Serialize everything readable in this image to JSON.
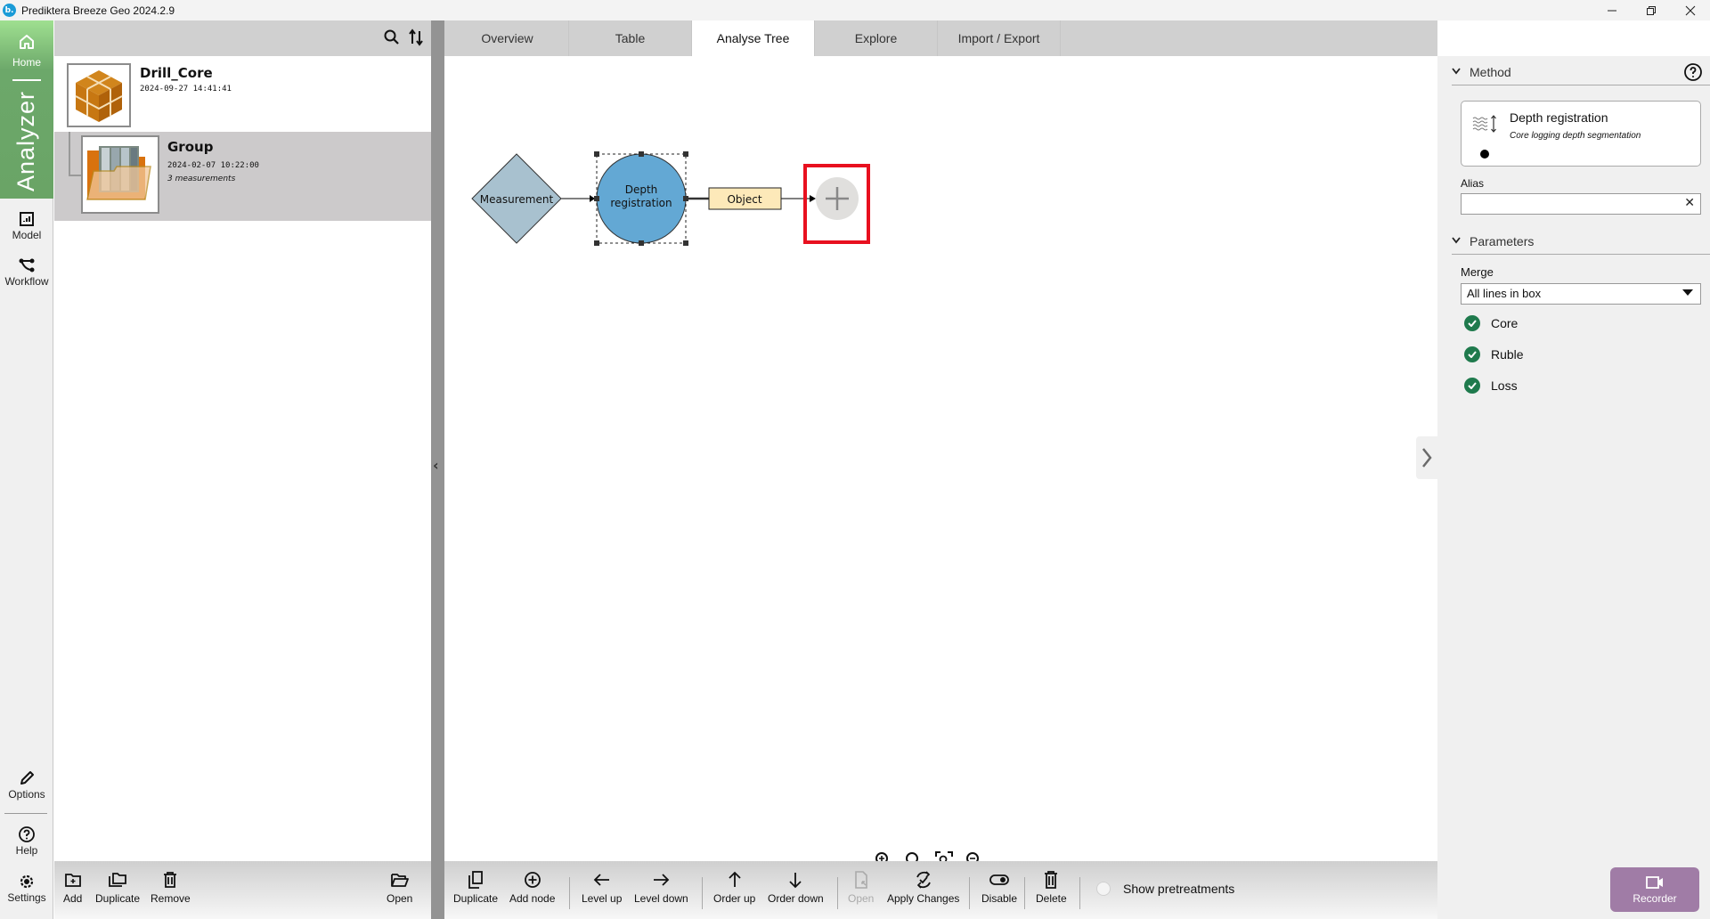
{
  "window": {
    "title": "Prediktera Breeze Geo 2024.2.9",
    "logo_letter": "b.",
    "controls": [
      "minimize",
      "restore",
      "close"
    ]
  },
  "rail": {
    "home_label": "Home",
    "section_label": "Analyzer",
    "items": [
      {
        "label": "Model",
        "icon": "model-chart-icon"
      },
      {
        "label": "Workflow",
        "icon": "workflow-icon"
      }
    ],
    "bottom_items": [
      {
        "label": "Options",
        "icon": "pencil-icon"
      },
      {
        "label": "Help",
        "icon": "help-icon"
      },
      {
        "label": "Settings",
        "icon": "gear-icon"
      }
    ]
  },
  "project_panel": {
    "tools": [
      "search-icon",
      "sort-icon"
    ],
    "items": [
      {
        "name": "Drill_Core",
        "date": "2024-09-27 14:41:41",
        "meta": "",
        "icon": "cube-boxes-icon"
      },
      {
        "name": "Group",
        "date": "2024-02-07 10:22:00",
        "meta": "3 measurements",
        "icon": "folder-images-icon",
        "selected": true
      }
    ],
    "footer_buttons": [
      {
        "label": "Add",
        "icon": "folder-add-icon"
      },
      {
        "label": "Duplicate",
        "icon": "folder-duplicate-icon"
      },
      {
        "label": "Remove",
        "icon": "trash-icon"
      },
      {
        "label": "Open",
        "icon": "folder-open-icon"
      }
    ]
  },
  "tabs": [
    {
      "label": "Overview",
      "active": false
    },
    {
      "label": "Table",
      "active": false
    },
    {
      "label": "Analyse Tree",
      "active": true
    },
    {
      "label": "Explore",
      "active": false
    },
    {
      "label": "Import / Export",
      "active": false
    }
  ],
  "tree": {
    "nodes": [
      {
        "label": "Measurement",
        "shape": "diamond",
        "color": "#a8c1cf"
      },
      {
        "label_line1": "Depth",
        "label_line2": "registration",
        "shape": "circle",
        "color": "#63a8d4",
        "selected": true
      },
      {
        "label": "Object",
        "shape": "rect",
        "color": "#fde9b9"
      },
      {
        "label": "+",
        "shape": "add-circle",
        "color": "#e0dfdd",
        "highlighted": true
      }
    ],
    "highlight_color": "#e8101f"
  },
  "zoom_tools": [
    "zoom-in-icon",
    "zoom-reset-icon",
    "zoom-fit-icon",
    "zoom-out-icon"
  ],
  "main_footer": {
    "buttons": [
      {
        "label": "Duplicate",
        "icon": "duplicate-icon",
        "enabled": true
      },
      {
        "label": "Add node",
        "icon": "add-node-icon",
        "enabled": true
      },
      {
        "label": "Level up",
        "icon": "arrow-left-icon",
        "enabled": true
      },
      {
        "label": "Level down",
        "icon": "arrow-right-icon",
        "enabled": true
      },
      {
        "label": "Order up",
        "icon": "arrow-up-icon",
        "enabled": true
      },
      {
        "label": "Order down",
        "icon": "arrow-down-icon",
        "enabled": true
      },
      {
        "label": "Open",
        "icon": "open-file-icon",
        "enabled": false
      },
      {
        "label": "Apply Changes",
        "icon": "apply-changes-icon",
        "enabled": true
      },
      {
        "label": "Disable",
        "icon": "toggle-icon",
        "enabled": true
      },
      {
        "label": "Delete",
        "icon": "trash-icon",
        "enabled": true
      }
    ],
    "show_pretreatments_label": "Show pretreatments",
    "show_pretreatments_checked": false
  },
  "recorder": {
    "label": "Recorder",
    "color": "#a07ca6"
  },
  "right_panel": {
    "method_header": "Method",
    "method": {
      "title": "Depth registration",
      "subtitle": "Core logging depth segmentation"
    },
    "alias_label": "Alias",
    "alias_value": "",
    "parameters_header": "Parameters",
    "merge_label": "Merge",
    "merge_value": "All lines in box",
    "checks": [
      {
        "label": "Core",
        "checked": true
      },
      {
        "label": "Ruble",
        "checked": true
      },
      {
        "label": "Loss",
        "checked": true
      }
    ],
    "check_color": "#1f7a4d"
  }
}
